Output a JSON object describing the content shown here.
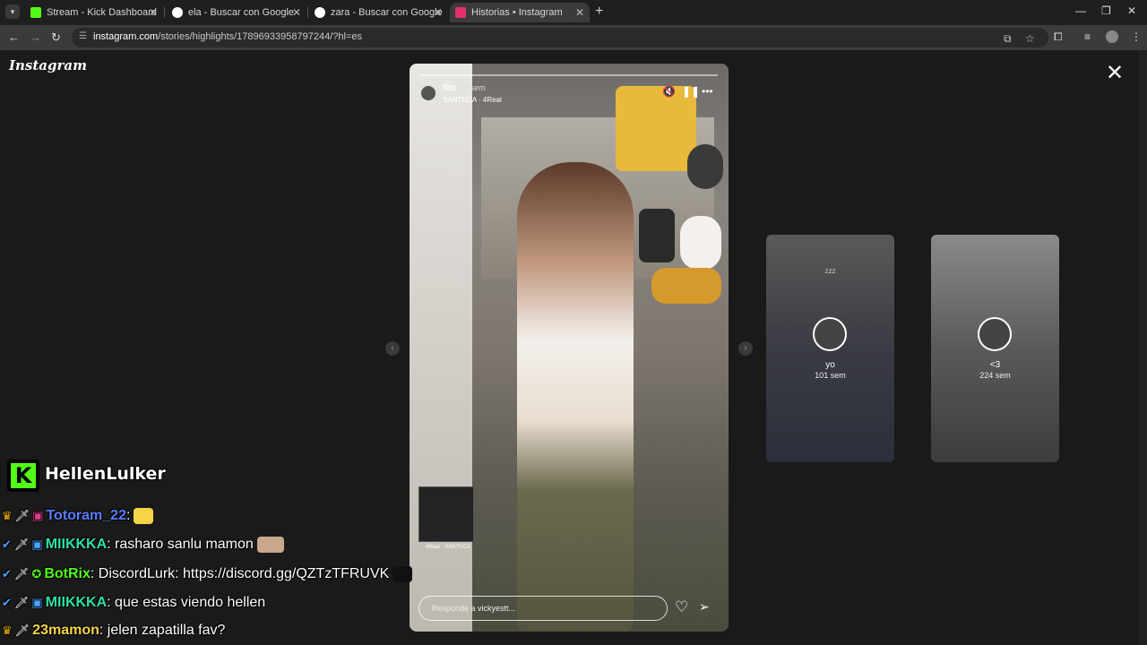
{
  "browser": {
    "tabs": [
      {
        "title": "Stream - Kick Dashboard",
        "favicon_color": "#53fc18",
        "active": false
      },
      {
        "title": "ela - Buscar con Google",
        "favicon_color": "#ffffff",
        "active": false
      },
      {
        "title": "zara - Buscar con Google",
        "favicon_color": "#ffffff",
        "active": false
      },
      {
        "title": "Historias • Instagram",
        "favicon_color": "#e1306c",
        "active": true
      }
    ],
    "url_host": "instagram.com",
    "url_path": "/stories/highlights/17896933958797244/?hl=es"
  },
  "instagram": {
    "logo": "Instagram",
    "story": {
      "username": "fits",
      "time": "37 sem",
      "song": "SANTUCA · 4Real",
      "music_sticker_label": "4Real · SANTUCA",
      "reply_placeholder": "Responde a vickyestt..."
    },
    "previews": [
      {
        "name": "yo",
        "time": "101 sem",
        "caption": "zzz"
      },
      {
        "name": "<3",
        "time": "224 sem",
        "caption": ""
      }
    ]
  },
  "chat": {
    "streamer": "HellenLulker",
    "brand_color": "#53fc18",
    "messages": [
      {
        "user": "Totoram_22",
        "user_color": "#5b7cff",
        "text": ":",
        "badges": [
          "crown-icon",
          "sword-icon",
          "sub-badge-icon"
        ]
      },
      {
        "user": "MIIKKKA",
        "user_color": "#2ee3a1",
        "text": ": rasharo sanlu mamon",
        "badges": [
          "sword-check-icon",
          "sword-icon",
          "sub-badge-icon"
        ]
      },
      {
        "user": "BotRix",
        "user_color": "#53fc18",
        "text": ": DiscordLurk: https://discord.gg/QZTzTFRUVK",
        "badges": [
          "sword-check-icon",
          "sword-icon",
          "verified-icon"
        ]
      },
      {
        "user": "MIIKKKA",
        "user_color": "#2ee3a1",
        "text": ": que estas viendo hellen",
        "badges": [
          "sword-check-icon",
          "sword-icon",
          "sub-badge-icon"
        ]
      },
      {
        "user": "23mamon",
        "user_color": "#f5d547",
        "text": ": jelen zapatilla fav?",
        "badges": [
          "crown-icon",
          "sword-icon"
        ]
      }
    ]
  }
}
